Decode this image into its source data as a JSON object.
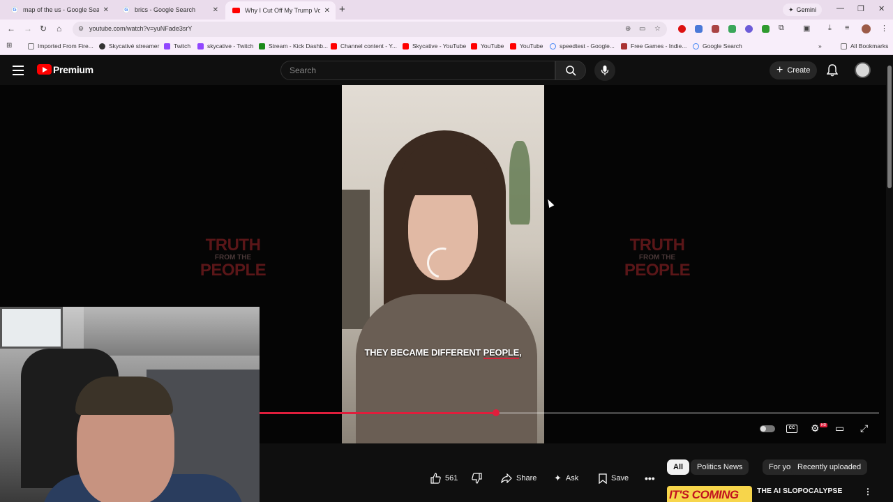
{
  "browser": {
    "tabs": [
      {
        "title": "map of the us - Google Search",
        "icon": "google-icon"
      },
      {
        "title": "brics - Google Search",
        "icon": "google-icon"
      },
      {
        "title": "Why I Cut Off My Trump Voting",
        "icon": "youtube-icon"
      }
    ],
    "gemini_label": "Gemini",
    "url": "youtube.com/watch?v=yuNFade3srY",
    "bookmarks": [
      "Imported From Fire...",
      "Skycativé streamer",
      "Twitch",
      "skycative - Twitch",
      "Stream - Kick Dashb...",
      "Channel content - Y...",
      "Skycative - YouTube",
      "YouTube",
      "YouTube",
      "speedtest - Google...",
      "Free Games - Indie...",
      "Google Search"
    ],
    "all_bookmarks": "All Bookmarks"
  },
  "youtube": {
    "brand": "Premium",
    "search_placeholder": "Search",
    "create_label": "Create"
  },
  "player": {
    "watermark": {
      "line1": "TRUTH",
      "line2": "FROM THE",
      "line3": "PEOPLE"
    },
    "caption_pre": "THEY BECAME DIFFERENT ",
    "caption_highlight": "PEOPLE",
    "caption_post": ",",
    "progress": 0.382
  },
  "actions": {
    "like_count": "561",
    "share_label": "Share",
    "ask_label": "Ask",
    "save_label": "Save"
  },
  "chips": [
    "All",
    "Politics News",
    "For you",
    "Recently uploaded"
  ],
  "recommendation": {
    "thumb_text": "IT'S COMING",
    "title": "THE AI SLOPOCALYPSE"
  },
  "colors": {
    "accent": "#e01e3c",
    "brand": "#ff0000"
  }
}
